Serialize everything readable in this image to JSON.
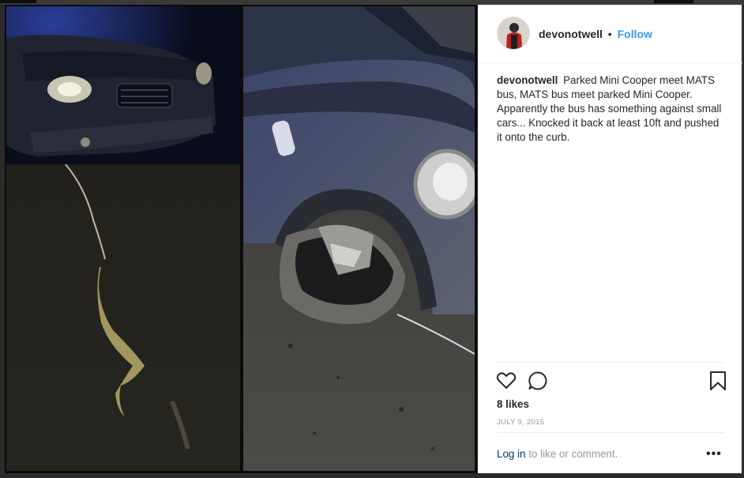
{
  "post": {
    "username": "devonotwell",
    "separator": "•",
    "follow_label": "Follow",
    "caption_username": "devonotwell",
    "caption_text": "Parked Mini Cooper meet MATS bus, MATS bus meet parked Mini Cooper. Apparently the bus has something against small cars... Knocked it back at least 10ft and pushed it onto the curb.",
    "likes": "8 likes",
    "date": "JULY 9, 2015",
    "login_link": "Log in",
    "login_rest": " to like or comment.",
    "more_label": "•••"
  },
  "icons": {
    "like": "heart-icon",
    "comment": "comment-icon",
    "save": "bookmark-icon"
  },
  "colors": {
    "link_blue": "#3897f0",
    "text": "#262626",
    "muted": "#999999",
    "login_link": "#003569"
  }
}
